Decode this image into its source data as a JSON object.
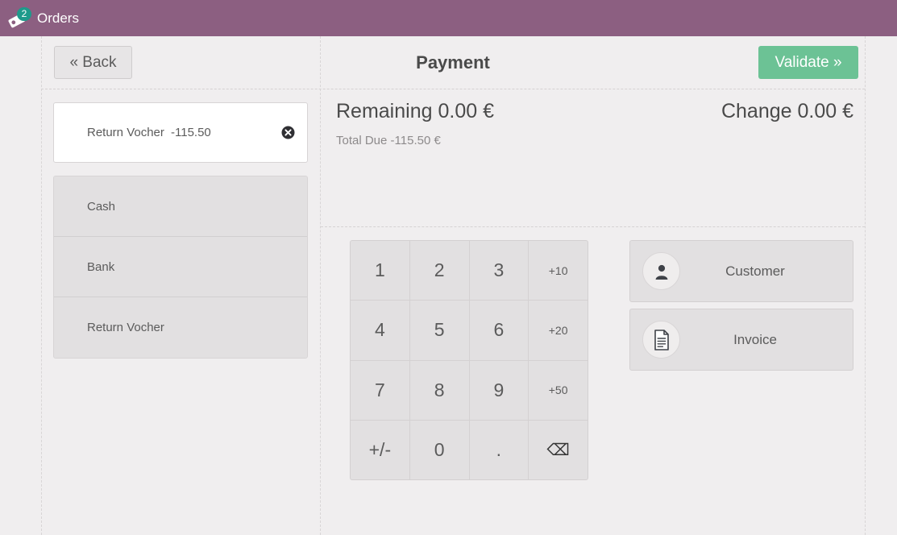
{
  "topbar": {
    "background_color": "#8c5f81",
    "icon_name": "orders-tag-icon",
    "order_count": "2",
    "badge_color": "#1f9a8b",
    "label": "Orders"
  },
  "header": {
    "back_label": "« Back",
    "title": "Payment",
    "validate_label": "Validate »",
    "validate_color": "#6cc295"
  },
  "payment_lines": [
    {
      "name": "Return Vocher",
      "amount": "-115.50",
      "delete_icon": "remove-circle-icon"
    }
  ],
  "payment_methods": [
    {
      "label": "Cash"
    },
    {
      "label": "Bank"
    },
    {
      "label": "Return Vocher"
    }
  ],
  "totals": {
    "remaining_label": "Remaining",
    "remaining_value": "0.00 €",
    "change_label": "Change",
    "change_value": "0.00 €",
    "total_due_label": "Total Due",
    "total_due_value": "-115.50 €"
  },
  "numpad": {
    "keys": [
      {
        "label": "1",
        "style": "digit",
        "name": "numpad-key-1"
      },
      {
        "label": "2",
        "style": "digit",
        "name": "numpad-key-2"
      },
      {
        "label": "3",
        "style": "digit",
        "name": "numpad-key-3"
      },
      {
        "label": "+10",
        "style": "small",
        "name": "numpad-key-plus-10"
      },
      {
        "label": "4",
        "style": "digit",
        "name": "numpad-key-4"
      },
      {
        "label": "5",
        "style": "digit",
        "name": "numpad-key-5"
      },
      {
        "label": "6",
        "style": "digit",
        "name": "numpad-key-6"
      },
      {
        "label": "+20",
        "style": "small",
        "name": "numpad-key-plus-20"
      },
      {
        "label": "7",
        "style": "digit",
        "name": "numpad-key-7"
      },
      {
        "label": "8",
        "style": "digit",
        "name": "numpad-key-8"
      },
      {
        "label": "9",
        "style": "digit",
        "name": "numpad-key-9"
      },
      {
        "label": "+50",
        "style": "small",
        "name": "numpad-key-plus-50"
      },
      {
        "label": "+/-",
        "style": "digit",
        "name": "numpad-key-sign"
      },
      {
        "label": "0",
        "style": "digit",
        "name": "numpad-key-0"
      },
      {
        "label": ".",
        "style": "digit",
        "name": "numpad-key-decimal"
      },
      {
        "label": "⌫",
        "style": "glyph",
        "name": "numpad-key-backspace"
      }
    ]
  },
  "actions": [
    {
      "label": "Customer",
      "icon": "person-icon",
      "name": "customer-button"
    },
    {
      "label": "Invoice",
      "icon": "document-icon",
      "name": "invoice-button"
    }
  ]
}
